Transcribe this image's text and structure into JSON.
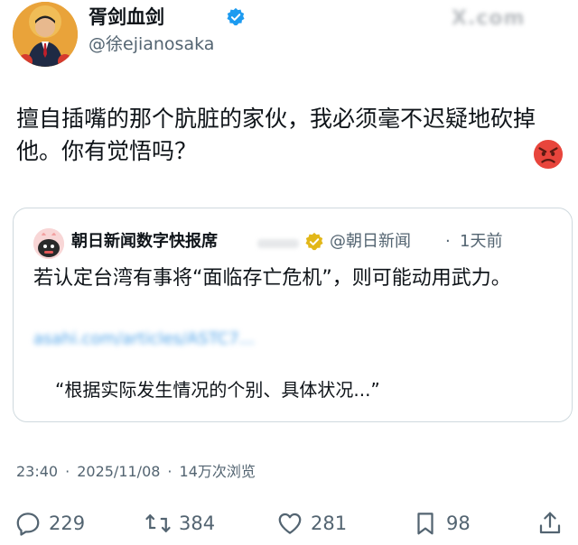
{
  "header": {
    "display_name": "胥剑血剑",
    "handle": "@徐ejianosaka",
    "watermark": "X.com"
  },
  "tweet": {
    "text": "擅自插嘴的那个肮脏的家伙，我必须毫不迟疑地砍掉他。你有觉悟吗？"
  },
  "quote": {
    "name": "朝日新闻数字快报席",
    "handle": "@朝日新闻",
    "dot": "·",
    "time": "1天前",
    "text": "若认定台湾有事将“面临存亡危机”，则可能动用武力。",
    "link": "asahi.com/articles/ASTC7...",
    "excerpt": "“根据实际发生情况的个别、具体状况...”"
  },
  "meta": {
    "time": "23:40",
    "dot1": "·",
    "date": "2025/11/08",
    "dot2": "·",
    "views": "14万次浏览"
  },
  "actions": {
    "replies": "229",
    "retweets": "384",
    "likes": "281",
    "bookmarks": "98"
  },
  "colors": {
    "verified": "#1d9bf0",
    "gold_verified": "#e2b719",
    "text": "#0f1419",
    "secondary": "#536471"
  }
}
